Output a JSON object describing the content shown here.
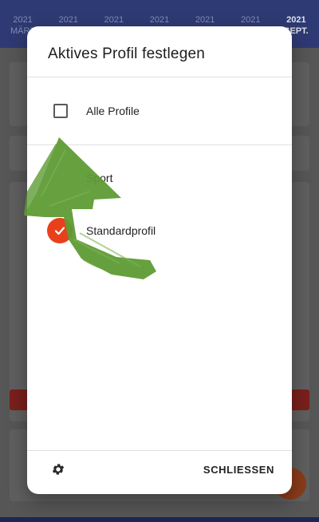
{
  "background": {
    "months": [
      {
        "year": "2021",
        "month": "MÄRZ"
      },
      {
        "year": "2021",
        "month": ""
      },
      {
        "year": "2021",
        "month": ""
      },
      {
        "year": "2021",
        "month": ""
      },
      {
        "year": "2021",
        "month": ""
      },
      {
        "year": "2021",
        "month": ""
      },
      {
        "year": "2021",
        "month": "SEPT."
      }
    ]
  },
  "dialog": {
    "title": "Aktives Profil festlegen",
    "all_profiles_label": "Alle Profile",
    "profiles": [
      {
        "label": "Sport",
        "selected": false
      },
      {
        "label": "Standardprofil",
        "selected": true
      }
    ],
    "close_label": "SCHLIESSEN",
    "settings_icon": "gear-icon"
  },
  "colors": {
    "accent": "#e8401c",
    "header": "#2e3a73",
    "annotation": "#5e9b35"
  }
}
